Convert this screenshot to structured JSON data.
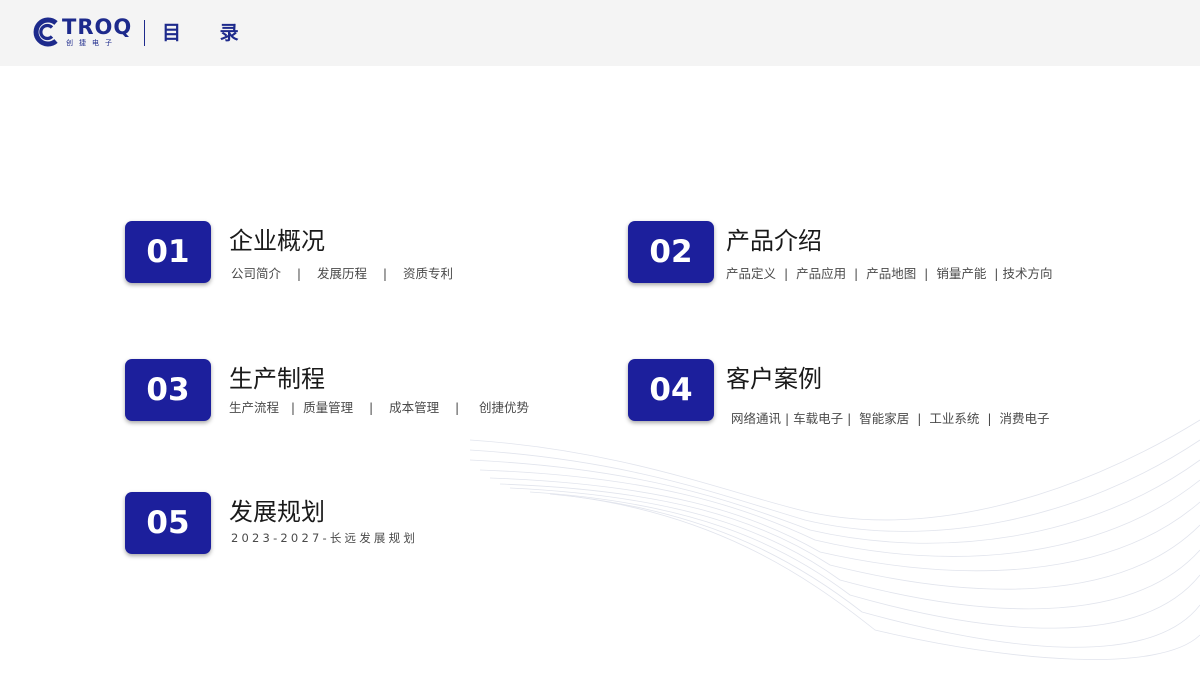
{
  "header": {
    "logo_text": "TROQ",
    "logo_sub": "创捷电子",
    "title": "目 录"
  },
  "colors": {
    "brand": "#1d2a8c",
    "number_box": "#1c1f9c",
    "header_bg": "#f4f4f4"
  },
  "sections": [
    {
      "number": "01",
      "title": "企业概况",
      "subtitle": "公司简介    |    发展历程    |    资质专利"
    },
    {
      "number": "02",
      "title": "产品介绍",
      "subtitle": "产品定义  |  产品应用  |  产品地图  |  销量产能  | 技术方向"
    },
    {
      "number": "03",
      "title": "生产制程",
      "subtitle": "生产流程   |  质量管理    |    成本管理    |     创捷优势"
    },
    {
      "number": "04",
      "title": "客户案例",
      "subtitle": "网络通讯 | 车载电子 |  智能家居  |  工业系统  |  消费电子"
    },
    {
      "number": "05",
      "title": "发展规划",
      "subtitle": "2023-2027-长远发展规划"
    }
  ]
}
